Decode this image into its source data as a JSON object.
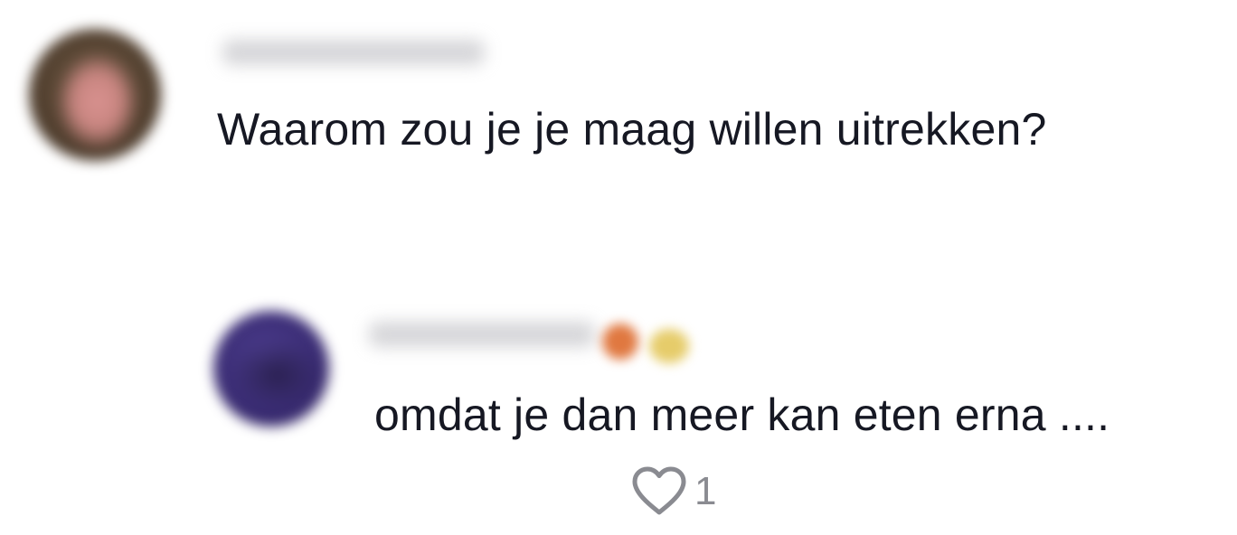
{
  "comment": {
    "text": "Waarom zou je je maag willen uitrekken?",
    "avatar_icon": "avatar-blurred",
    "username_visible": false
  },
  "reply": {
    "text": "omdat je dan meer kan eten erna ....",
    "avatar_icon": "avatar-blurred",
    "username_visible": false,
    "like_icon": "heart-outline-icon",
    "like_count": "1"
  },
  "colors": {
    "text": "#161823",
    "secondary_text": "#8a8b91",
    "background": "#ffffff"
  }
}
